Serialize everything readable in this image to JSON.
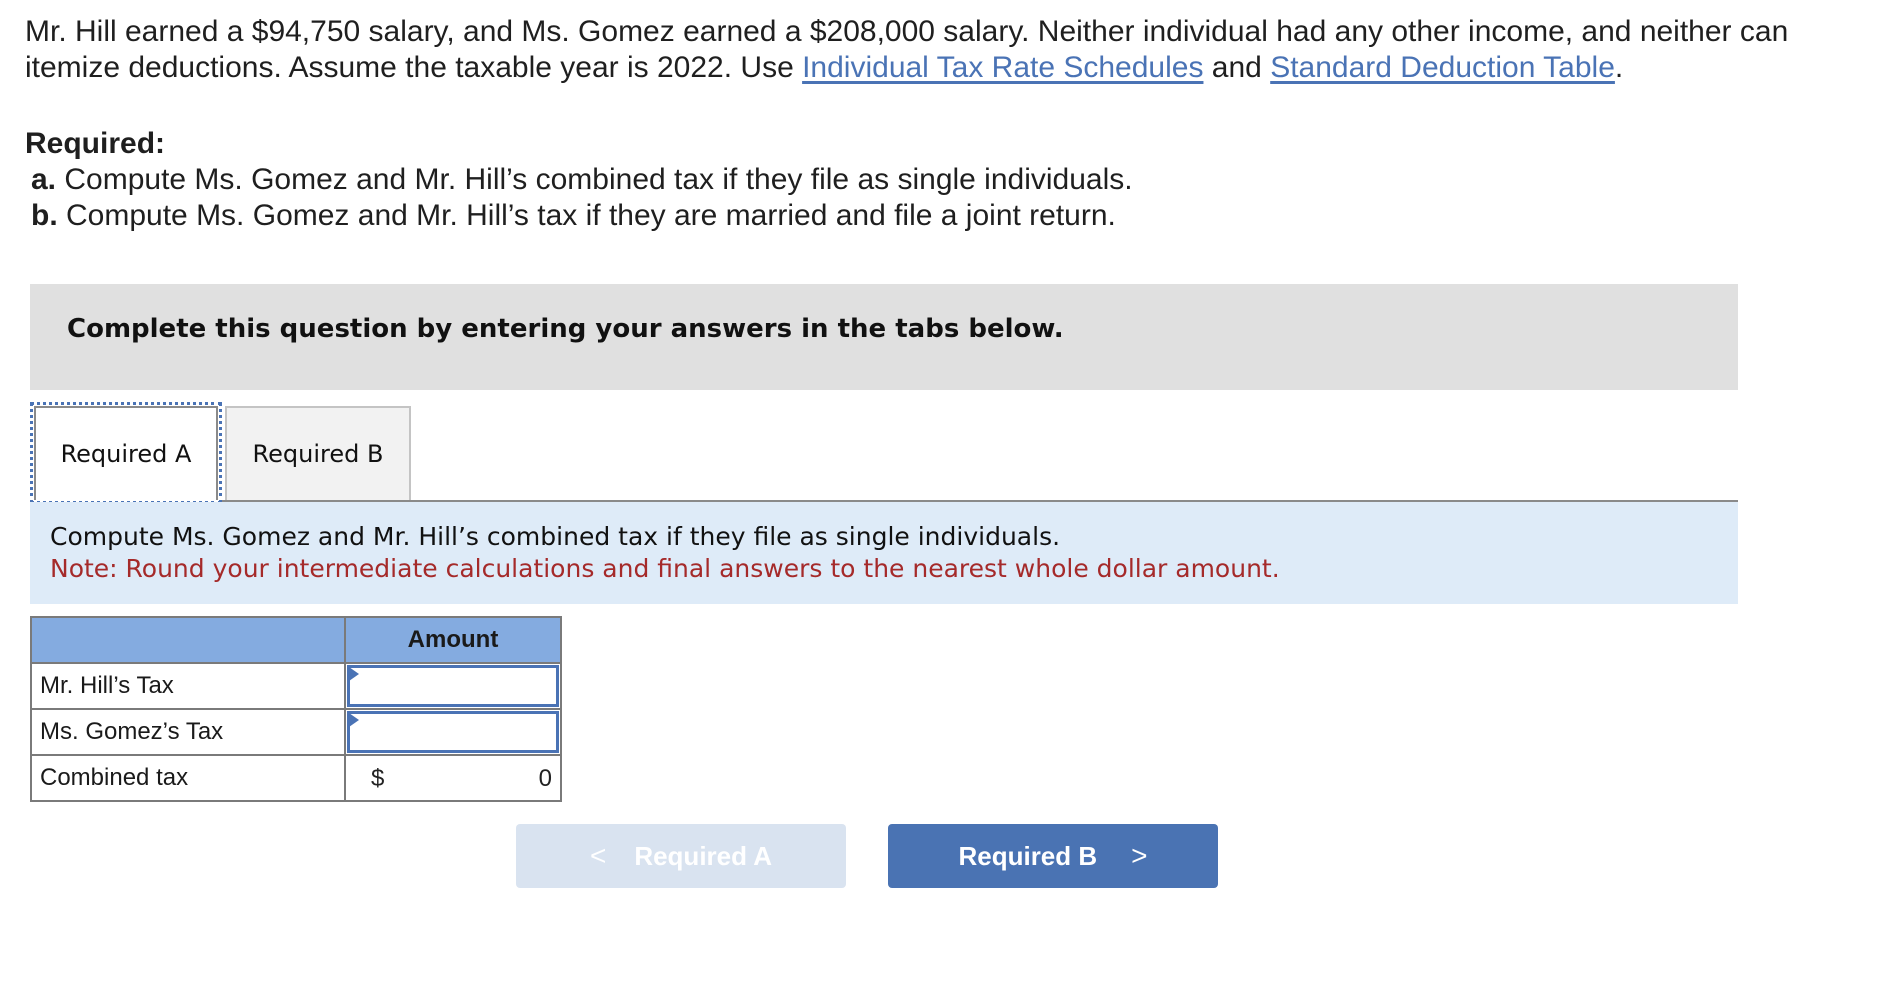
{
  "problem": {
    "text_1": "Mr. Hill earned a $94,750 salary, and Ms. Gomez earned a $208,000 salary. Neither individual had any other income, and neither can itemize deductions. Assume the taxable year is 2022. Use ",
    "link_1": "Individual Tax Rate Schedules",
    "text_2": " and ",
    "link_2": "Standard Deduction Table",
    "text_3": "."
  },
  "required": {
    "heading": "Required:",
    "items": [
      {
        "marker": "a.",
        "text": " Compute Ms. Gomez and Mr. Hill’s combined tax if they file as single individuals."
      },
      {
        "marker": "b.",
        "text": " Compute Ms. Gomez and Mr. Hill’s tax if they are married and file a joint return."
      }
    ]
  },
  "instruction_box": "Complete this question by entering your answers in the tabs below.",
  "tabs": [
    {
      "label": "Required A",
      "active": true
    },
    {
      "label": "Required B",
      "active": false
    }
  ],
  "panel": {
    "question": "Compute Ms. Gomez and Mr. Hill’s combined tax if they file as single individuals.",
    "note": "Note: Round your intermediate calculations and final answers to the nearest whole dollar amount."
  },
  "table": {
    "header": [
      "",
      "Amount"
    ],
    "rows": [
      {
        "label": "Mr. Hill’s Tax",
        "value": ""
      },
      {
        "label": "Ms. Gomez’s Tax",
        "value": ""
      },
      {
        "label": "Combined tax",
        "currency": "$",
        "value": "0"
      }
    ]
  },
  "nav": {
    "prev_label": "Required A",
    "prev_icon": "chevron-left-icon",
    "prev_glyph": "<",
    "next_label": "Required B",
    "next_icon": "chevron-right-icon",
    "next_glyph": ">"
  },
  "colors": {
    "link": "#4a73b5",
    "note": "#a52a2a",
    "header_fill": "#84abe0",
    "panel_fill": "#deebf8",
    "next_button": "#4a73b3",
    "prev_button_disabled": "#d9e3f0"
  }
}
